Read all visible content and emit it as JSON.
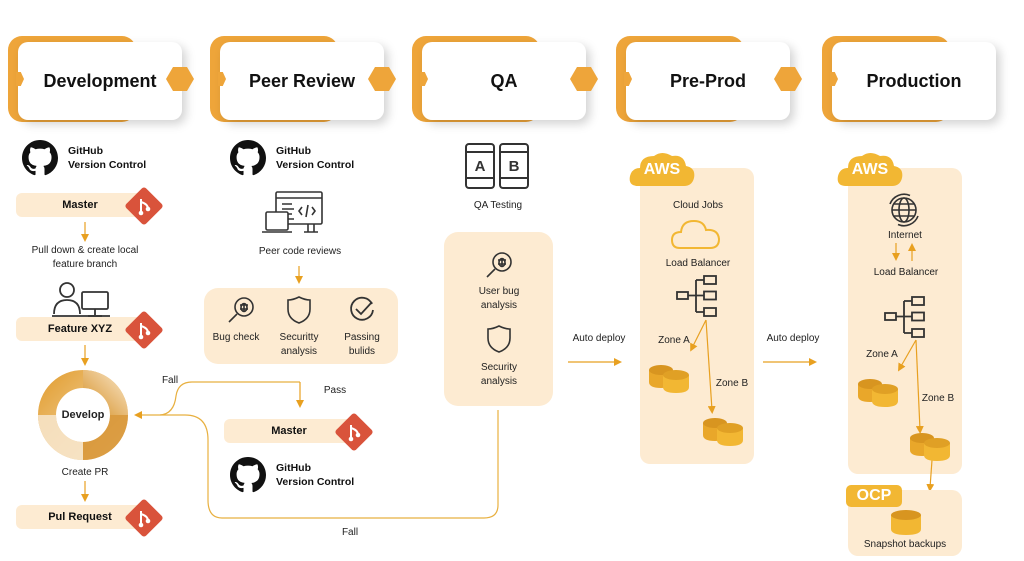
{
  "colors": {
    "accent": "#eeA53a",
    "panel": "#fdebd2",
    "git": "#d9533b",
    "line": "#e8b040",
    "db": "#f2b733",
    "aws": "#f2b733"
  },
  "stages": [
    {
      "label": "Development"
    },
    {
      "label": "Peer Review"
    },
    {
      "label": "QA"
    },
    {
      "label": "Pre-Prod"
    },
    {
      "label": "Production"
    }
  ],
  "development": {
    "github": {
      "line1": "GitHub",
      "line2": "Version Control",
      "icon": "github-icon"
    },
    "master": "Master",
    "pull_down": {
      "line1": "Pull down & create local",
      "line2": "feature branch"
    },
    "feature": "Feature XYZ",
    "develop": "Develop",
    "create_pr": "Create PR",
    "pull_request": "Pul Request"
  },
  "peer_review": {
    "github": {
      "line1": "GitHub",
      "line2": "Version Control"
    },
    "code_reviews": "Peer code reviews",
    "checks": [
      {
        "line1": "Bug check",
        "line2": "",
        "icon": "bug-search-icon"
      },
      {
        "line1": "Securitty",
        "line2": "analysis",
        "icon": "shield-icon"
      },
      {
        "line1": "Passing",
        "line2": "bulids",
        "icon": "check-circle-icon"
      }
    ],
    "pass": "Pass",
    "fall_top": "Fall",
    "fall_bottom": "Fall",
    "master": "Master",
    "github_bottom": {
      "line1": "GitHub",
      "line2": "Version Control"
    }
  },
  "qa": {
    "testing_label": "QA Testing",
    "ab_icon": {
      "a": "A",
      "b": "B"
    },
    "items": [
      {
        "line1": "User bug",
        "line2": "analysis",
        "icon": "bug-search-icon"
      },
      {
        "line1": "Security",
        "line2": "analysis",
        "icon": "shield-icon"
      }
    ]
  },
  "auto_deploy_1": "Auto deploy",
  "auto_deploy_2": "Auto deploy",
  "pre_prod": {
    "badge": "AWS",
    "cloud_jobs": "Cloud Jobs",
    "load_balancer": "Load Balancer",
    "zone_a": "Zone A",
    "zone_b": "Zone B"
  },
  "production": {
    "badge": "AWS",
    "internet": "Internet",
    "load_balancer": "Load Balancer",
    "zone_a": "Zone A",
    "zone_b": "Zone B",
    "ocp_badge": "OCP",
    "snapshot": "Snapshot backups"
  }
}
